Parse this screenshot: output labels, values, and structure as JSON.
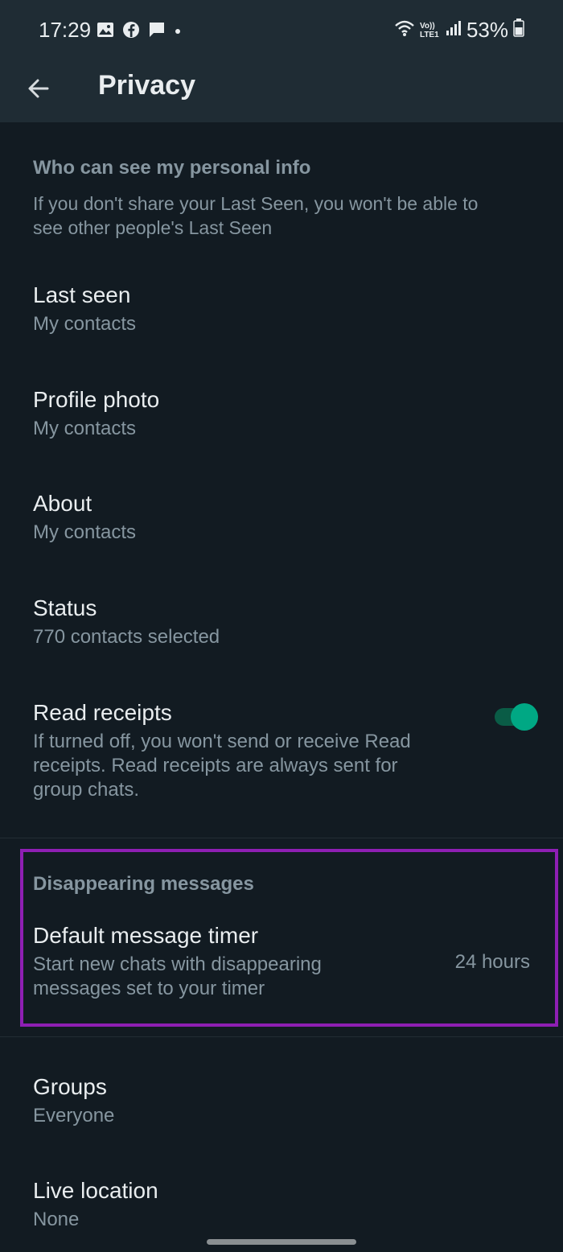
{
  "status_bar": {
    "time": "17:29",
    "battery": "53%",
    "network_label": "Vo)) LTE1",
    "icons": [
      "image-icon",
      "facebook-icon",
      "message-icon",
      "dot-icon",
      "wifi-icon",
      "signal-icon",
      "battery-icon"
    ]
  },
  "app_bar": {
    "title": "Privacy",
    "back_icon": "arrow-left-icon"
  },
  "personal_info": {
    "header": "Who can see my personal info",
    "description_line1": "If you don't share your Last Seen, you won't be able to",
    "description_line2": "see other people's Last Seen"
  },
  "items": [
    {
      "title": "Last seen",
      "subtitle": "My contacts"
    },
    {
      "title": "Profile photo",
      "subtitle": "My contacts"
    },
    {
      "title": "About",
      "subtitle": "My contacts"
    },
    {
      "title": "Status",
      "subtitle": "770 contacts selected"
    }
  ],
  "read_receipts": {
    "title": "Read receipts",
    "description_line1": "If turned off, you won't send or receive Read",
    "description_line2": "receipts. Read receipts are always sent for",
    "description_line3": "group chats.",
    "enabled": true
  },
  "disappearing": {
    "header": "Disappearing messages",
    "title": "Default message timer",
    "description_line1": "Start new chats with disappearing",
    "description_line2": "messages set to your timer",
    "value": "24 hours"
  },
  "more_items": [
    {
      "title": "Groups",
      "subtitle": "Everyone"
    },
    {
      "title": "Live location",
      "subtitle": "None"
    }
  ],
  "colors": {
    "background": "#121b22",
    "app_bar": "#1f2c34",
    "primary_text": "#e9edef",
    "secondary_text": "#8696a0",
    "accent": "#00a884",
    "highlight": "#8e1fb3"
  }
}
